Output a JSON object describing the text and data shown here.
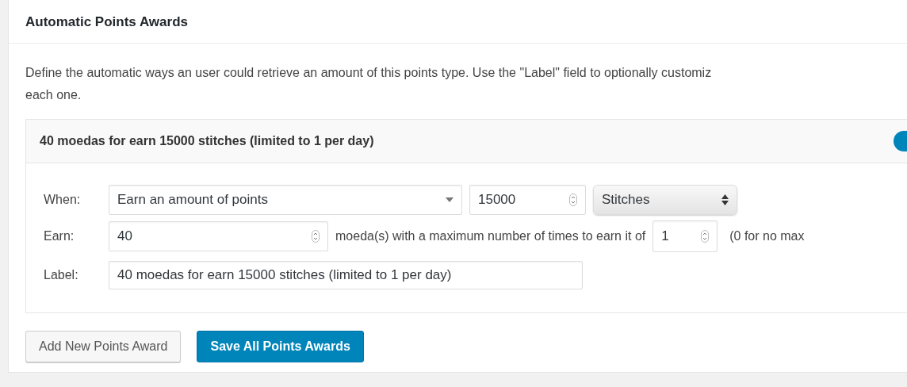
{
  "section": {
    "title": "Automatic Points Awards",
    "description": [
      "Define the automatic ways an user could retrieve an amount of this points type. Use the \"Label\" field to optionally customiz",
      "each one."
    ]
  },
  "award": {
    "title": "40 moedas for earn 15000 stitches (limited to 1 per day)",
    "toggle": {
      "on": true
    },
    "when": {
      "label": "When:",
      "trigger": "Earn an amount of points",
      "amount": "15000",
      "points_type": "Stitches"
    },
    "earn": {
      "label": "Earn:",
      "amount": "40",
      "text": "moeda(s) with a maximum number of times to earn it of",
      "limit": "1",
      "note": "(0 for no max"
    },
    "label": {
      "label": "Label:",
      "value": "40 moedas for earn 15000 stitches (limited to 1 per day)"
    }
  },
  "buttons": [
    {
      "label": "Add New Points Award",
      "kind": "secondary"
    },
    {
      "label": "Save All Points Awards",
      "kind": "primary"
    }
  ]
}
